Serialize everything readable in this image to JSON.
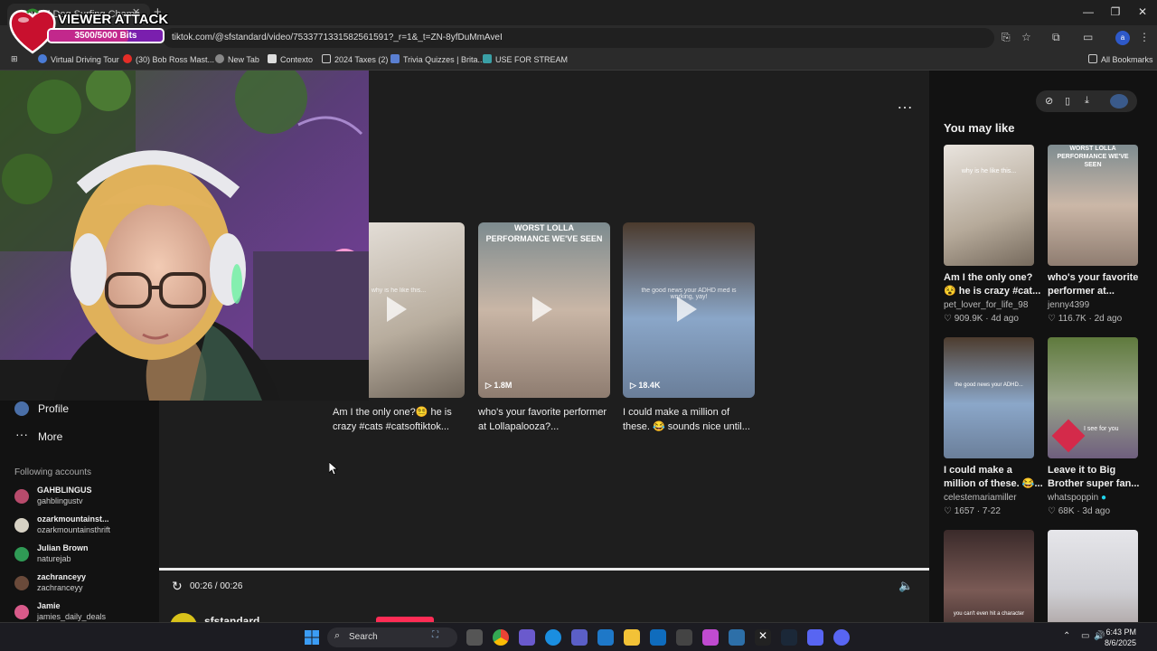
{
  "browser": {
    "tab_title": "Wild Dog Surfing Champ",
    "url": "tiktok.com/@sfstandard/video/7533771331582561591?_r=1&_t=ZN-8yfDuMmAveI",
    "bookmarks": [
      "Virtual Driving Tour",
      "(30) Bob Ross Mast...",
      "New Tab",
      "Contexto",
      "2024 Taxes (2)",
      "Trivia Quizzes | Brita...",
      "USE FOR STREAM"
    ],
    "all_bookmarks": "All Bookmarks",
    "profile_initial": "a"
  },
  "overlay": {
    "title": "VIEWER ATTACK",
    "bits_text": "3500/5000 Bits",
    "progress_fraction": 0.7
  },
  "sidebar": {
    "profile_label": "Profile",
    "more_label": "More",
    "following_title": "Following accounts",
    "accounts": [
      {
        "name": "GAHBLINGUS",
        "handle": "gahblingustv",
        "color": "#b84b6c"
      },
      {
        "name": "ozarkmountainst...",
        "handle": "ozarkmountainsthrift",
        "color": "#d7d2c4"
      },
      {
        "name": "Julian Brown",
        "handle": "naturejab",
        "color": "#2f9a55"
      },
      {
        "name": "zachranceyy",
        "handle": "zachranceyy",
        "color": "#6a4a3a"
      },
      {
        "name": "Jamie",
        "handle": "jamies_daily_deals",
        "color": "#d85a8a"
      }
    ]
  },
  "player": {
    "more_icon": "…",
    "thumbs": [
      {
        "overlay": "",
        "mid": "why is he like this...",
        "views": "",
        "caption": "Am I the only one?😵‍💫 he is crazy #cats #catsoftiktok..."
      },
      {
        "overlay": "WORST LOLLA PERFORMANCE WE'VE SEEN",
        "mid": "",
        "views": "1.8M",
        "caption": "who's your favorite performer at Lollapalooza?..."
      },
      {
        "overlay": "",
        "mid": "the good news your ADHD med is working, yay!",
        "views": "18.4K",
        "caption": "I could make a million of these. 😂 sounds nice until..."
      }
    ],
    "time": "00:26 / 00:26",
    "author": "sfstandard"
  },
  "right": {
    "title": "You may like",
    "cards": [
      {
        "overlay": "why is he like this...",
        "title": "Am I the only one? 😵 he is crazy #cat...",
        "user": "pet_lover_for_life_98",
        "meta": "♡ 909.9K · 4d ago"
      },
      {
        "overlay": "WORST LOLLA PERFORMANCE WE'VE SEEN",
        "title": "who's your favorite performer at...",
        "user": "jenny4399",
        "meta": "♡ 116.7K · 2d ago"
      },
      {
        "overlay": "the good news your ADHD...",
        "title": "I could make a million of these. 😂...",
        "user": "celestemariamiller",
        "meta": "♡ 1657 · 7-22"
      },
      {
        "overlay": "I see for you",
        "title": "Leave it to Big Brother super fan...",
        "user": "whatspoppin",
        "meta": "♡ 68K · 3d ago"
      },
      {
        "overlay": "you can't even hit a character",
        "title": "",
        "user": "",
        "meta": ""
      },
      {
        "overlay": "",
        "title": "",
        "user": "",
        "meta": ""
      }
    ]
  },
  "taskbar": {
    "search_label": "Search",
    "time": "6:43 PM",
    "date": "8/6/2025"
  }
}
